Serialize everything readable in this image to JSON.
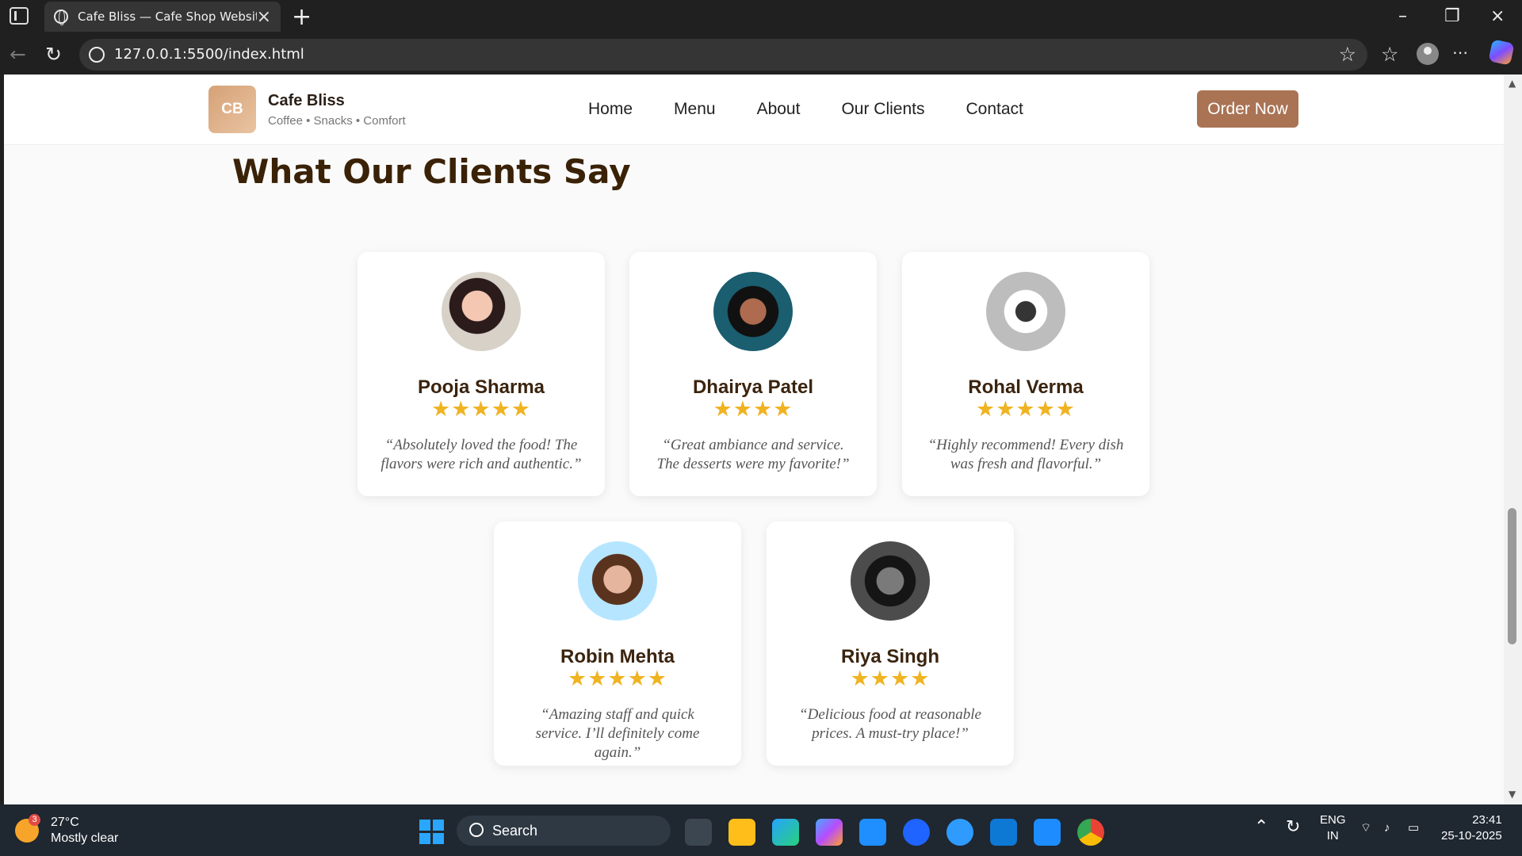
{
  "browser": {
    "tab_title": "Cafe Bliss — Cafe Shop Website",
    "url": "127.0.0.1:5500/index.html"
  },
  "site": {
    "logo": "CB",
    "brand": "Cafe Bliss",
    "tagline": "Coffee • Snacks • Comfort",
    "nav": [
      "Home",
      "Menu",
      "About",
      "Our Clients",
      "Contact"
    ],
    "order_button": "Order Now",
    "section_title": "What Our Clients Say"
  },
  "testimonials": [
    {
      "name": "Pooja Sharma",
      "rating": 5,
      "quote": "“Absolutely loved the food! The flavors were rich and authentic.”"
    },
    {
      "name": "Dhairya Patel",
      "rating": 4,
      "quote": "“Great ambiance and service. The desserts were my favorite!”"
    },
    {
      "name": "Rohal Verma",
      "rating": 5,
      "quote": "“Highly recommend! Every dish was fresh and flavorful.”"
    },
    {
      "name": "Robin Mehta",
      "rating": 5,
      "quote": "“Amazing staff and quick service. I’ll definitely come again.”"
    },
    {
      "name": "Riya Singh",
      "rating": 4,
      "quote": "“Delicious food at reasonable prices. A must-try place!”"
    }
  ],
  "taskbar": {
    "weather_badge": "3",
    "temperature": "27°C",
    "condition": "Mostly clear",
    "search_placeholder": "Search",
    "language": "ENG",
    "region": "IN",
    "time": "23:41",
    "date": "25-10-2025"
  },
  "colors": {
    "accent": "#a97354",
    "heading": "#3a2207",
    "star": "#f0b321"
  }
}
